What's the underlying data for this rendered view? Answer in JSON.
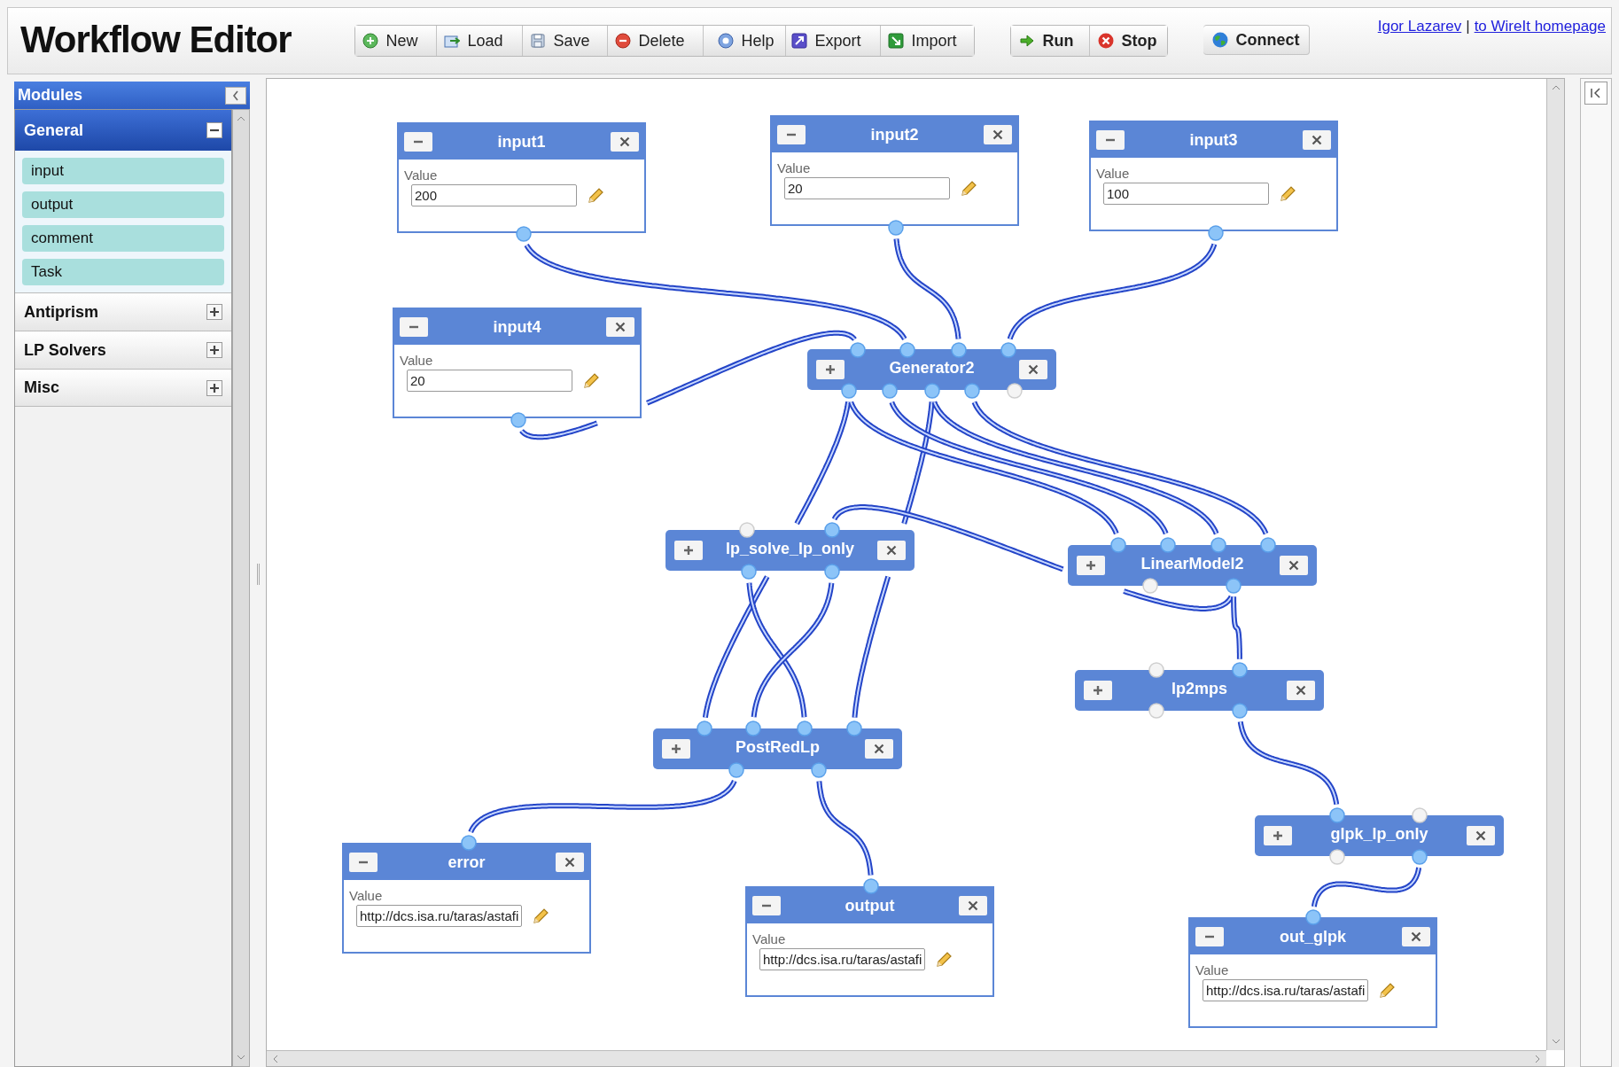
{
  "app": {
    "title": "Workflow Editor"
  },
  "toolbar": [
    {
      "label": "New",
      "kind": "new"
    },
    {
      "label": "Load",
      "kind": "load"
    },
    {
      "label": "Save",
      "kind": "save"
    },
    {
      "label": "Delete",
      "kind": "delete"
    },
    {
      "label": "Help",
      "kind": "help"
    },
    {
      "label": "Export",
      "kind": "export"
    },
    {
      "label": "Import",
      "kind": "import"
    }
  ],
  "run_controls": [
    {
      "label": "Run",
      "kind": "run"
    },
    {
      "label": "Stop",
      "kind": "stop"
    }
  ],
  "connect": {
    "label": "Connect"
  },
  "links": [
    {
      "label": "Igor Lazarev"
    },
    {
      "label": "to WireIt homepage"
    }
  ],
  "link_separator": "|",
  "sidebar": {
    "title": "Modules",
    "groups": [
      {
        "label": "General",
        "expanded": true,
        "items": [
          "input",
          "output",
          "comment",
          "Task"
        ]
      },
      {
        "label": "Antiprism",
        "expanded": false
      },
      {
        "label": "LP Solvers",
        "expanded": false
      },
      {
        "label": "Misc",
        "expanded": false
      }
    ]
  },
  "nodes": [
    {
      "title": "input1",
      "kind": "form",
      "field_label": "Value",
      "value": "200"
    },
    {
      "title": "input2",
      "kind": "form",
      "field_label": "Value",
      "value": "20"
    },
    {
      "title": "input3",
      "kind": "form",
      "field_label": "Value",
      "value": "100"
    },
    {
      "title": "input4",
      "kind": "form",
      "field_label": "Value",
      "value": "20"
    },
    {
      "title": "Generator2",
      "kind": "bar"
    },
    {
      "title": "lp_solve_lp_only",
      "kind": "bar"
    },
    {
      "title": "LinearModel2",
      "kind": "bar"
    },
    {
      "title": "lp2mps",
      "kind": "bar"
    },
    {
      "title": "PostRedLp",
      "kind": "bar"
    },
    {
      "title": "glpk_lp_only",
      "kind": "bar"
    },
    {
      "title": "error",
      "kind": "form",
      "field_label": "Value",
      "value": "http://dcs.isa.ru/taras/astafi"
    },
    {
      "title": "output",
      "kind": "form",
      "field_label": "Value",
      "value": "http://dcs.isa.ru/taras/astafi"
    },
    {
      "title": "out_glpk",
      "kind": "form",
      "field_label": "Value",
      "value": "http://dcs.isa.ru/taras/astafi"
    }
  ]
}
